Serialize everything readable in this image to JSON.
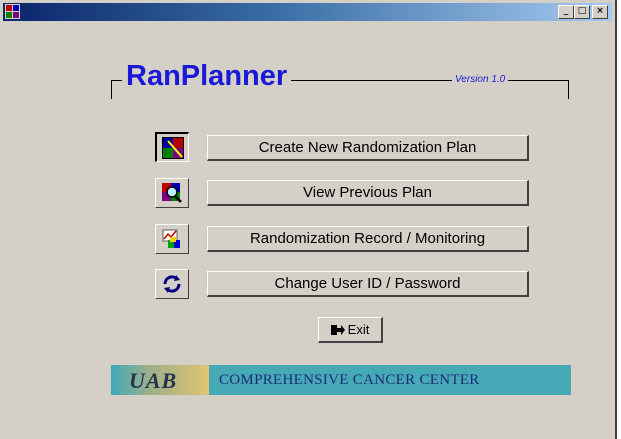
{
  "window": {
    "controls": {
      "minimize": "_",
      "maximize": "□",
      "close": "×"
    }
  },
  "header": {
    "title": "RanPlanner",
    "version": "Version 1.0"
  },
  "actions": [
    {
      "label": "Create New Randomization Plan",
      "icon": "plan-grid-icon"
    },
    {
      "label": "View Previous Plan",
      "icon": "magnifier-plan-icon"
    },
    {
      "label": "Randomization Record / Monitoring",
      "icon": "chart-record-icon"
    },
    {
      "label": "Change User ID / Password",
      "icon": "user-password-icon"
    }
  ],
  "exit": {
    "label": "Exit",
    "icon": "exit-door-icon"
  },
  "banner": {
    "logo": "UAB",
    "text": "COMPREHENSIVE CANCER CENTER"
  },
  "colors": {
    "title_blue": "#1a1ad6",
    "face": "#d4d0c8",
    "banner_teal": "#3fa9b5",
    "banner_text": "#1c2a7a"
  }
}
